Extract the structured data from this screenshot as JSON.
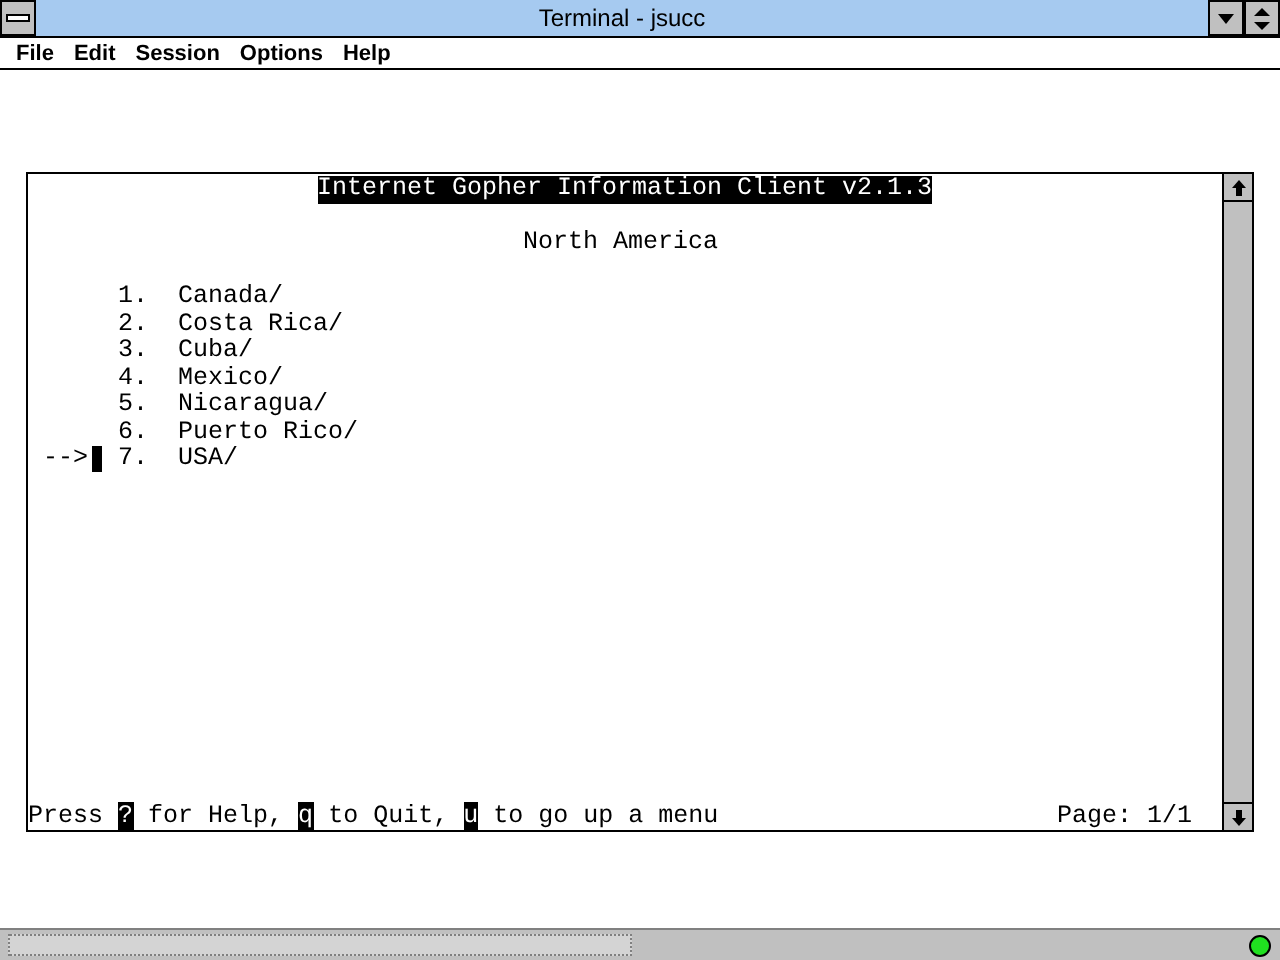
{
  "window": {
    "title": "Terminal - jsucc"
  },
  "menu": [
    {
      "label": "File"
    },
    {
      "label": "Edit"
    },
    {
      "label": "Session"
    },
    {
      "label": "Options"
    },
    {
      "label": "Help"
    }
  ],
  "terminal": {
    "title": "Internet Gopher Information Client v2.1.3",
    "heading": "North America",
    "pointer": "-->",
    "items": [
      {
        "number": "1.",
        "label": "Canada/",
        "selected": false
      },
      {
        "number": "2.",
        "label": "Costa Rica/",
        "selected": false
      },
      {
        "number": "3.",
        "label": "Cuba/",
        "selected": false
      },
      {
        "number": "4.",
        "label": "Mexico/",
        "selected": false
      },
      {
        "number": "5.",
        "label": "Nicaragua/",
        "selected": false
      },
      {
        "number": "6.",
        "label": "Puerto Rico/",
        "selected": false
      },
      {
        "number": "7.",
        "label": "USA/",
        "selected": true
      }
    ],
    "prompt": [
      {
        "kind": "text",
        "text": "Press "
      },
      {
        "kind": "key",
        "text": "?"
      },
      {
        "kind": "text",
        "text": " for Help, "
      },
      {
        "kind": "key",
        "text": "q"
      },
      {
        "kind": "text",
        "text": " to Quit, "
      },
      {
        "kind": "key",
        "text": "u"
      },
      {
        "kind": "text",
        "text": " to go up a menu"
      }
    ],
    "page": "Page: 1/1"
  }
}
